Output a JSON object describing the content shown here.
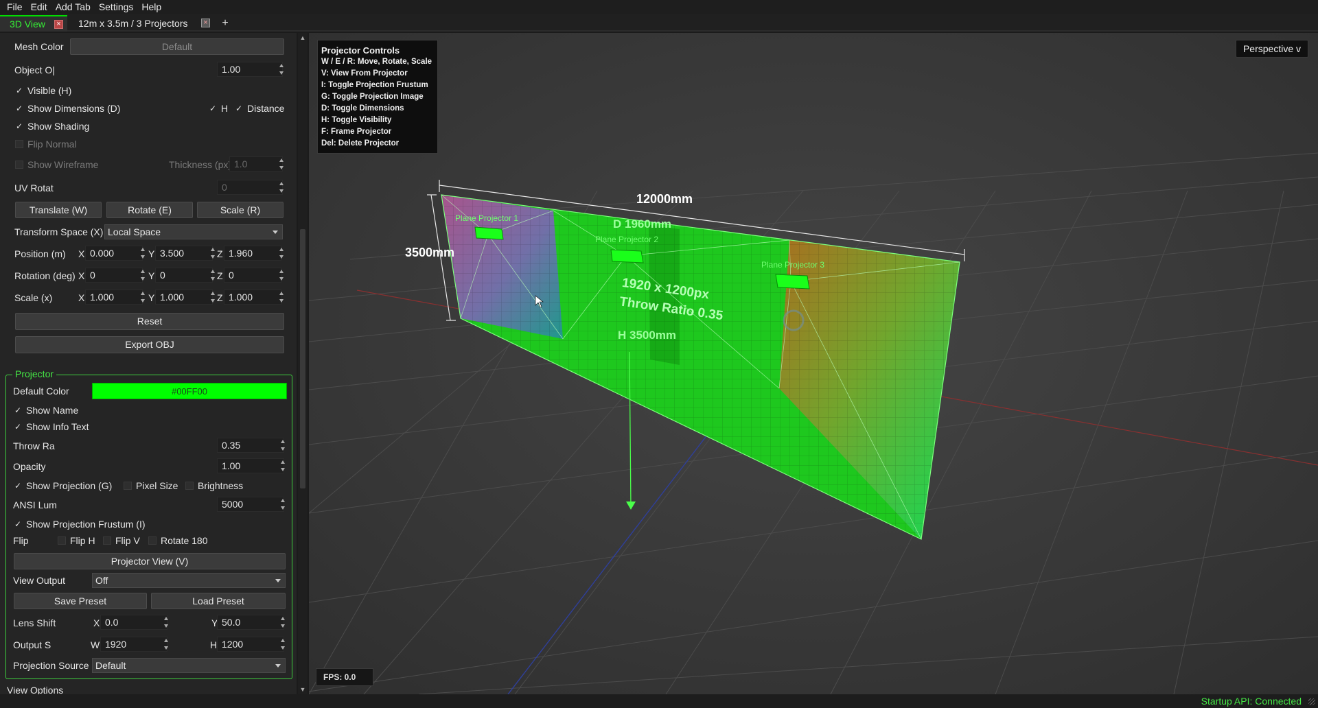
{
  "menu": [
    "File",
    "Edit",
    "Add Tab",
    "Settings",
    "Help"
  ],
  "tabs": {
    "active": "3D View",
    "second": "12m x 3.5m / 3 Projectors",
    "close_glyph": "×",
    "add": "+"
  },
  "mesh": {
    "mesh_color_label": "Mesh Color",
    "mesh_color_value": "Default",
    "object_opacity_label": "Object O|",
    "object_opacity_value": "1.00",
    "visible_label": "Visible (H)",
    "show_dimensions_label": "Show Dimensions (D)",
    "dim_h_label": "H",
    "dim_distance_label": "Distance",
    "show_shading_label": "Show Shading",
    "flip_normal_label": "Flip Normal",
    "show_wireframe_label": "Show Wireframe",
    "thickness_label": "Thickness (px)",
    "thickness_value": "1.0",
    "uv_rotat_label": "UV Rotat",
    "uv_rotat_value": "0",
    "translate_btn": "Translate (W)",
    "rotate_btn": "Rotate (E)",
    "scale_btn": "Scale (R)",
    "transform_space_label": "Transform Space (X)",
    "transform_space_value": "Local Space",
    "position_label": "Position (m)",
    "rotation_label": "Rotation (deg)",
    "scale_label": "Scale (x)",
    "axis_x": "X",
    "axis_y": "Y",
    "axis_z": "Z",
    "position": [
      "0.000",
      "3.500",
      "1.960"
    ],
    "rotation": [
      "0",
      "0",
      "0"
    ],
    "scale": [
      "1.000",
      "1.000",
      "1.000"
    ],
    "reset_btn": "Reset",
    "export_btn": "Export OBJ"
  },
  "projector": {
    "section_title": "Projector",
    "default_color_label": "Default Color",
    "default_color_value": "#00FF00",
    "show_name_label": "Show Name",
    "show_info_label": "Show Info Text",
    "throw_label": "Throw Ra",
    "throw_value": "0.35",
    "opacity_label": "Opacity",
    "opacity_value": "1.00",
    "show_projection_label": "Show Projection (G)",
    "pixel_size_label": "Pixel Size",
    "brightness_label": "Brightness",
    "ansi_label": "ANSI Lum",
    "ansi_value": "5000",
    "show_frustum_label": "Show Projection Frustum (I)",
    "flip_label": "Flip",
    "flip_h_label": "Flip H",
    "flip_v_label": "Flip V",
    "rotate180_label": "Rotate 180",
    "projector_view_btn": "Projector View (V)",
    "view_output_label": "View Output",
    "view_output_value": "Off",
    "save_preset_btn": "Save Preset",
    "load_preset_btn": "Load Preset",
    "lens_shift_label": "Lens Shift",
    "lens_shift_x_label": "X",
    "lens_shift_x_value": "0.0",
    "lens_shift_y_label": "Y",
    "lens_shift_y_value": "50.0",
    "output_size_label": "Output S",
    "output_w_label": "W",
    "output_w_value": "1920",
    "output_h_label": "H",
    "output_h_value": "1200",
    "projection_source_label": "Projection Source",
    "projection_source_value": "Default"
  },
  "view_options_label": "View Options",
  "viewport": {
    "controls_title": "Projector Controls",
    "controls": [
      "W / E / R: Move, Rotate, Scale",
      "V: View From Projector",
      "I: Toggle Projection Frustum",
      "G: Toggle Projection Image",
      "D: Toggle Dimensions",
      "H: Toggle Visibility",
      "F: Frame Projector",
      "Del: Delete Projector"
    ],
    "perspective": "Perspective v",
    "fps": "FPS: 0.0",
    "dim_width": "12000mm",
    "dim_height": "3500mm",
    "dim_depth": "D 1960mm",
    "dim_h": "H 3500mm",
    "info_resolution": "1920 x 1200px",
    "info_throw": "Throw Ratio 0.35",
    "projector_names": [
      "Plane Projector 1",
      "Plane Projector 2",
      "Plane Projector 3"
    ]
  },
  "status": "Startup API: Connected",
  "colors": {
    "accent": "#00ff00",
    "status_ok": "#45e645"
  }
}
